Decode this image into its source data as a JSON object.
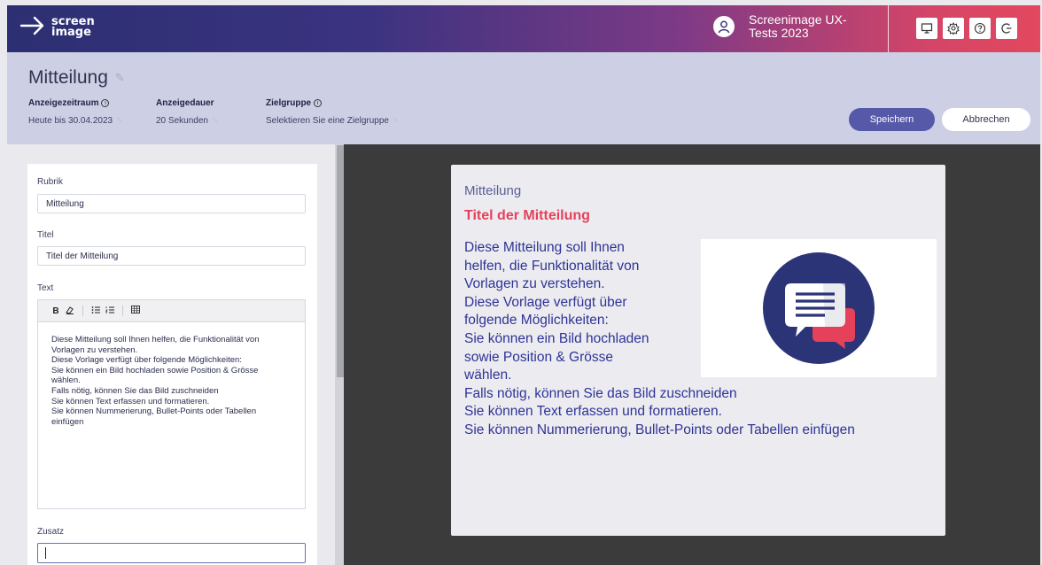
{
  "topbar": {
    "logo_line1": "screen",
    "logo_line2": "image",
    "user_name": "Screenimage UX-Tests 2023",
    "icons": [
      "monitor-icon",
      "gear-icon",
      "help-icon",
      "logout-icon"
    ]
  },
  "header": {
    "title": "Mitteilung",
    "fields": [
      {
        "label": "Anzeigezeitraum",
        "value": "Heute bis 30.04.2023",
        "has_info": true
      },
      {
        "label": "Anzeigedauer",
        "value": "20 Sekunden",
        "has_info": false
      },
      {
        "label": "Zielgruppe",
        "value": "Selektieren Sie eine Zielgruppe",
        "has_info": true
      }
    ],
    "save_label": "Speichern",
    "cancel_label": "Abbrechen"
  },
  "editor": {
    "rubrik_label": "Rubrik",
    "rubrik_value": "Mitteilung",
    "titel_label": "Titel",
    "titel_value": "Titel der Mitteilung",
    "text_label": "Text",
    "toolbar": [
      "B",
      "eraser",
      "bullet-list",
      "numbered-list",
      "table"
    ],
    "text_lines": [
      "Diese Mitteilung soll Ihnen helfen, die Funktionalität von",
      "Vorlagen zu verstehen.",
      "Diese Vorlage verfügt über folgende Möglichkeiten:",
      "Sie können ein Bild hochladen sowie Position & Grösse",
      "wählen.",
      "Falls nötig, können Sie das Bild zuschneiden",
      "Sie können Text erfassen und formatieren.",
      "Sie können Nummerierung, Bullet-Points oder Tabellen",
      "einfügen"
    ],
    "zusatz_label": "Zusatz",
    "zusatz_value": ""
  },
  "preview": {
    "rubrik": "Mitteilung",
    "title": "Titel der Mitteilung",
    "lines": [
      "Diese Mitteilung soll Ihnen",
      "helfen, die Funktionalität von",
      "Vorlagen zu verstehen.",
      "Diese Vorlage verfügt über",
      "folgende Möglichkeiten:",
      "Sie können ein Bild hochladen",
      "sowie Position & Grösse",
      "wählen.",
      "Falls nötig, können Sie das Bild zuschneiden",
      "Sie können Text erfassen und formatieren.",
      "Sie können Nummerierung, Bullet-Points oder Tabellen einfügen"
    ],
    "image_icon": "chat-bubbles-icon"
  },
  "colors": {
    "brand_dark": "#2c2f72",
    "brand_accent": "#e2485e",
    "title_red": "#e5415a",
    "text_blue": "#2f3396",
    "save_button": "#5659a8"
  }
}
